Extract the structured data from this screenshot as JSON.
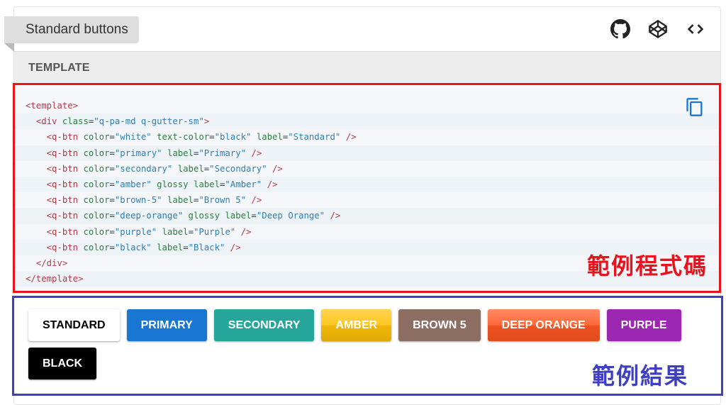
{
  "header": {
    "title": "Standard buttons",
    "icons": [
      "github-icon",
      "codepen-icon",
      "code-icon"
    ]
  },
  "tabs": {
    "active_label": "TEMPLATE"
  },
  "code": {
    "lines": [
      [
        [
          "tag",
          "<template>"
        ]
      ],
      [
        [
          "pun",
          "  "
        ],
        [
          "tag",
          "<div"
        ],
        [
          "pun",
          " "
        ],
        [
          "attr",
          "class"
        ],
        [
          "pun",
          "="
        ],
        [
          "str",
          "\"q-pa-md q-gutter-sm\""
        ],
        [
          "tag",
          ">"
        ]
      ],
      [
        [
          "pun",
          "    "
        ],
        [
          "tag",
          "<q-btn"
        ],
        [
          "pun",
          " "
        ],
        [
          "attr",
          "color"
        ],
        [
          "pun",
          "="
        ],
        [
          "str",
          "\"white\""
        ],
        [
          "pun",
          " "
        ],
        [
          "attr",
          "text-color"
        ],
        [
          "pun",
          "="
        ],
        [
          "str",
          "\"black\""
        ],
        [
          "pun",
          " "
        ],
        [
          "attr",
          "label"
        ],
        [
          "pun",
          "="
        ],
        [
          "str",
          "\"Standard\""
        ],
        [
          "pun",
          " "
        ],
        [
          "tag",
          "/>"
        ]
      ],
      [
        [
          "pun",
          "    "
        ],
        [
          "tag",
          "<q-btn"
        ],
        [
          "pun",
          " "
        ],
        [
          "attr",
          "color"
        ],
        [
          "pun",
          "="
        ],
        [
          "str",
          "\"primary\""
        ],
        [
          "pun",
          " "
        ],
        [
          "attr",
          "label"
        ],
        [
          "pun",
          "="
        ],
        [
          "str",
          "\"Primary\""
        ],
        [
          "pun",
          " "
        ],
        [
          "tag",
          "/>"
        ]
      ],
      [
        [
          "pun",
          "    "
        ],
        [
          "tag",
          "<q-btn"
        ],
        [
          "pun",
          " "
        ],
        [
          "attr",
          "color"
        ],
        [
          "pun",
          "="
        ],
        [
          "str",
          "\"secondary\""
        ],
        [
          "pun",
          " "
        ],
        [
          "attr",
          "label"
        ],
        [
          "pun",
          "="
        ],
        [
          "str",
          "\"Secondary\""
        ],
        [
          "pun",
          " "
        ],
        [
          "tag",
          "/>"
        ]
      ],
      [
        [
          "pun",
          "    "
        ],
        [
          "tag",
          "<q-btn"
        ],
        [
          "pun",
          " "
        ],
        [
          "attr",
          "color"
        ],
        [
          "pun",
          "="
        ],
        [
          "str",
          "\"amber\""
        ],
        [
          "pun",
          " "
        ],
        [
          "attr",
          "glossy"
        ],
        [
          "pun",
          " "
        ],
        [
          "attr",
          "label"
        ],
        [
          "pun",
          "="
        ],
        [
          "str",
          "\"Amber\""
        ],
        [
          "pun",
          " "
        ],
        [
          "tag",
          "/>"
        ]
      ],
      [
        [
          "pun",
          "    "
        ],
        [
          "tag",
          "<q-btn"
        ],
        [
          "pun",
          " "
        ],
        [
          "attr",
          "color"
        ],
        [
          "pun",
          "="
        ],
        [
          "str",
          "\"brown-5\""
        ],
        [
          "pun",
          " "
        ],
        [
          "attr",
          "label"
        ],
        [
          "pun",
          "="
        ],
        [
          "str",
          "\"Brown 5\""
        ],
        [
          "pun",
          " "
        ],
        [
          "tag",
          "/>"
        ]
      ],
      [
        [
          "pun",
          "    "
        ],
        [
          "tag",
          "<q-btn"
        ],
        [
          "pun",
          " "
        ],
        [
          "attr",
          "color"
        ],
        [
          "pun",
          "="
        ],
        [
          "str",
          "\"deep-orange\""
        ],
        [
          "pun",
          " "
        ],
        [
          "attr",
          "glossy"
        ],
        [
          "pun",
          " "
        ],
        [
          "attr",
          "label"
        ],
        [
          "pun",
          "="
        ],
        [
          "str",
          "\"Deep Orange\""
        ],
        [
          "pun",
          " "
        ],
        [
          "tag",
          "/>"
        ]
      ],
      [
        [
          "pun",
          "    "
        ],
        [
          "tag",
          "<q-btn"
        ],
        [
          "pun",
          " "
        ],
        [
          "attr",
          "color"
        ],
        [
          "pun",
          "="
        ],
        [
          "str",
          "\"purple\""
        ],
        [
          "pun",
          " "
        ],
        [
          "attr",
          "label"
        ],
        [
          "pun",
          "="
        ],
        [
          "str",
          "\"Purple\""
        ],
        [
          "pun",
          " "
        ],
        [
          "tag",
          "/>"
        ]
      ],
      [
        [
          "pun",
          "    "
        ],
        [
          "tag",
          "<q-btn"
        ],
        [
          "pun",
          " "
        ],
        [
          "attr",
          "color"
        ],
        [
          "pun",
          "="
        ],
        [
          "str",
          "\"black\""
        ],
        [
          "pun",
          " "
        ],
        [
          "attr",
          "label"
        ],
        [
          "pun",
          "="
        ],
        [
          "str",
          "\"Black\""
        ],
        [
          "pun",
          " "
        ],
        [
          "tag",
          "/>"
        ]
      ],
      [
        [
          "pun",
          "  "
        ],
        [
          "tag",
          "</div>"
        ]
      ],
      [
        [
          "tag",
          "</template>"
        ]
      ]
    ],
    "annotation": "範例程式碼",
    "copy_icon": "copy-icon"
  },
  "result": {
    "buttons": [
      {
        "label": "Standard",
        "bg": "#ffffff",
        "fg": "#000000",
        "glossy": false
      },
      {
        "label": "Primary",
        "bg": "#1976d2",
        "fg": "#ffffff",
        "glossy": false
      },
      {
        "label": "Secondary",
        "bg": "#26a69a",
        "fg": "#ffffff",
        "glossy": false
      },
      {
        "label": "Amber",
        "bg": "#ffc107",
        "fg": "#ffffff",
        "glossy": true
      },
      {
        "label": "Brown 5",
        "bg": "#8d6e63",
        "fg": "#ffffff",
        "glossy": false
      },
      {
        "label": "Deep Orange",
        "bg": "#ff5722",
        "fg": "#ffffff",
        "glossy": true
      },
      {
        "label": "Purple",
        "bg": "#9c27b0",
        "fg": "#ffffff",
        "glossy": false
      },
      {
        "label": "Black",
        "bg": "#000000",
        "fg": "#ffffff",
        "glossy": false
      }
    ],
    "annotation": "範例結果"
  },
  "colors": {
    "code_border": "#e5141d",
    "result_border": "#3f3fc4"
  }
}
